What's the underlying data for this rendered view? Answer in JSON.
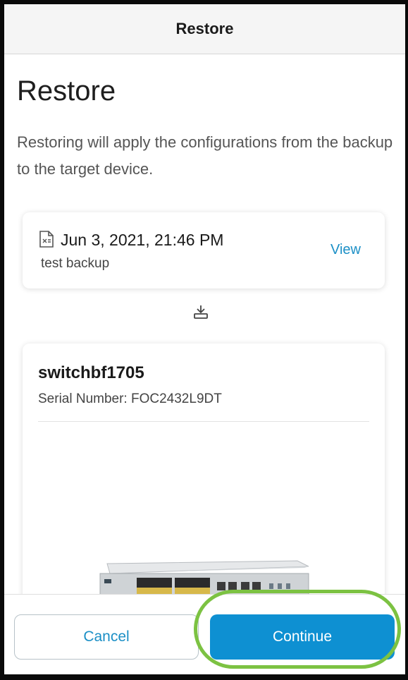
{
  "navbar": {
    "title": "Restore"
  },
  "page": {
    "title": "Restore",
    "description": "Restoring will apply the configurations from the backup to the target device."
  },
  "backup": {
    "icon": "file-backup-icon",
    "date": "Jun 3, 2021, 21:46 PM",
    "name": "test backup",
    "view_label": "View"
  },
  "transfer_icon": "download-arrow-icon",
  "device": {
    "name": "switchbf1705",
    "serial_label": "Serial Number:",
    "serial_value": "FOC2432L9DT"
  },
  "footer": {
    "cancel_label": "Cancel",
    "continue_label": "Continue"
  },
  "colors": {
    "accent": "#0e90d2",
    "link": "#1b8fc6",
    "highlight": "#7cc242"
  }
}
